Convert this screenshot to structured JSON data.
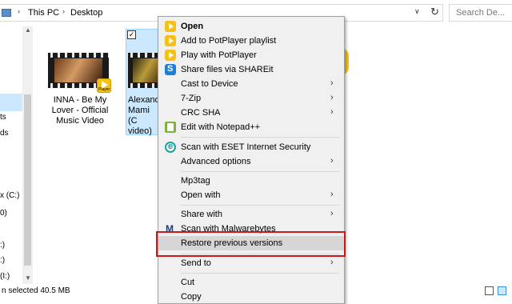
{
  "address": {
    "crumbs": [
      "This PC",
      "Desktop"
    ],
    "search_placeholder": "Search De..."
  },
  "nav": {
    "items": [
      "ts",
      "ds",
      "x (C:)",
      "0)",
      ":)",
      ":)",
      "(I:)"
    ]
  },
  "files": [
    {
      "name": "INNA - Be My Lover - Official Music Video",
      "badge": "Player"
    },
    {
      "name": "Alexand Mami (C video) #newsin",
      "selected": true
    }
  ],
  "context_menu": {
    "items": [
      {
        "label": "Open",
        "bold": true,
        "icon": "potplayer-icon"
      },
      {
        "label": "Add to PotPlayer playlist",
        "icon": "potplayer-icon"
      },
      {
        "label": "Play with PotPlayer",
        "icon": "potplayer-icon"
      },
      {
        "label": "Share files via SHAREit",
        "icon": "shareit-icon"
      },
      {
        "label": "Cast to Device",
        "submenu": true
      },
      {
        "label": "7-Zip",
        "submenu": true
      },
      {
        "label": "CRC SHA",
        "submenu": true
      },
      {
        "label": "Edit with Notepad++",
        "icon": "notepad-plus-plus-icon"
      },
      {
        "label": "Scan with ESET Internet Security",
        "icon": "eset-icon"
      },
      {
        "label": "Advanced options",
        "submenu": true
      },
      {
        "label": "Mp3tag"
      },
      {
        "label": "Open with",
        "submenu": true
      },
      {
        "label": "Share with",
        "submenu": true
      },
      {
        "label": "Scan with Malwarebytes",
        "icon": "malwarebytes-icon"
      },
      {
        "label": "Restore previous versions",
        "highlighted": true
      },
      {
        "label": "Send to",
        "submenu": true
      },
      {
        "label": "Cut"
      },
      {
        "label": "Copy"
      }
    ]
  },
  "status": {
    "text": "n selected  40.5 MB"
  },
  "colors": {
    "highlight_border": "#c81a1a",
    "selection": "#cce8ff",
    "menu_bg": "#f0f0f0"
  }
}
